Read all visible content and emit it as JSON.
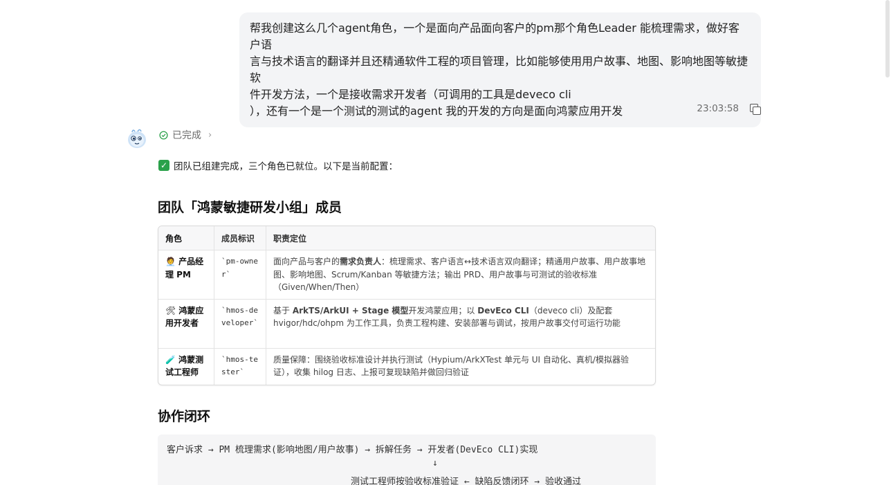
{
  "user_message": {
    "lines": [
      "帮我创建这么几个agent角色，一个是面向产品面向客户的pm那个角色Leader  能梳理需求，做好客户语",
      "言与技术语言的翻译并且还精通软件工程的项目管理，比如能够使用用户故事、地图、影响地图等敏捷软",
      "件开发方法，一个是接收需求开发者（可调用的工具是deveco cli",
      "），还有一个是一个测试的测试的agent    我的开发的方向是面向鸿蒙应用开发"
    ],
    "time": "23:03:58"
  },
  "assistant": {
    "status_icon": "check-circle-icon",
    "status": "已完成",
    "status_chevron": "›",
    "intro_check": "✓",
    "intro": "团队已组建完成，三个角色已就位。以下是当前配置：",
    "section1_title": "团队「鸿蒙敏捷研发小组」成员",
    "table": {
      "headers": [
        "角色",
        "成员标识",
        "职责定位"
      ],
      "rows": [
        {
          "emoji": "🧑‍💼",
          "role": "产品经理 PM",
          "id": "`pm-owner`",
          "desc_pre": "面向产品与客户的",
          "desc_bold": "需求负责人",
          "desc_post": "：梳理需求、客户语言↔技术语言双向翻译；精通用户故事、用户故事地图、影响地图、Scrum/Kanban 等敏捷方法；输出 PRD、用户故事与可测试的验收标准（Given/When/Then）"
        },
        {
          "emoji": "🛠",
          "role": "鸿蒙应用开发者",
          "id": "`hmos-developer`",
          "desc_pre": "基于 ",
          "desc_bold": "ArkTS/ArkUI + Stage 模型",
          "desc_mid": "开发鸿蒙应用；以 ",
          "desc_bold2": "DevEco CLI",
          "desc_post": "（deveco cli）及配套 hvigor/hdc/ohpm 为工作工具，负责工程构建、安装部署与调试，按用户故事交付可运行功能"
        },
        {
          "emoji": "🧪",
          "role": "鸿蒙测试工程师",
          "id": "`hmos-tester`",
          "desc_post": "质量保障：围绕验收标准设计并执行测试（Hypium/ArkXTest 单元与 UI 自动化、真机/模拟器验证），收集 hilog 日志、上报可复现缺陷并做回归验证"
        }
      ]
    },
    "section2_title": "协作闭环",
    "flow": {
      "line1": "客户诉求 → PM 梳理需求(影响地图/用户故事) → 拆解任务 → 开发者(DevEco CLI)实现",
      "line2": "↓",
      "line3": "测试工程师按验收标准验证 ← 缺陷反馈闭环 → 验收通过"
    }
  },
  "colors": {
    "bubble_bg": "#f3f4f6",
    "status_green": "#2aa14a",
    "table_border": "#d9d9d9",
    "code_bg": "#f5f5f6"
  }
}
